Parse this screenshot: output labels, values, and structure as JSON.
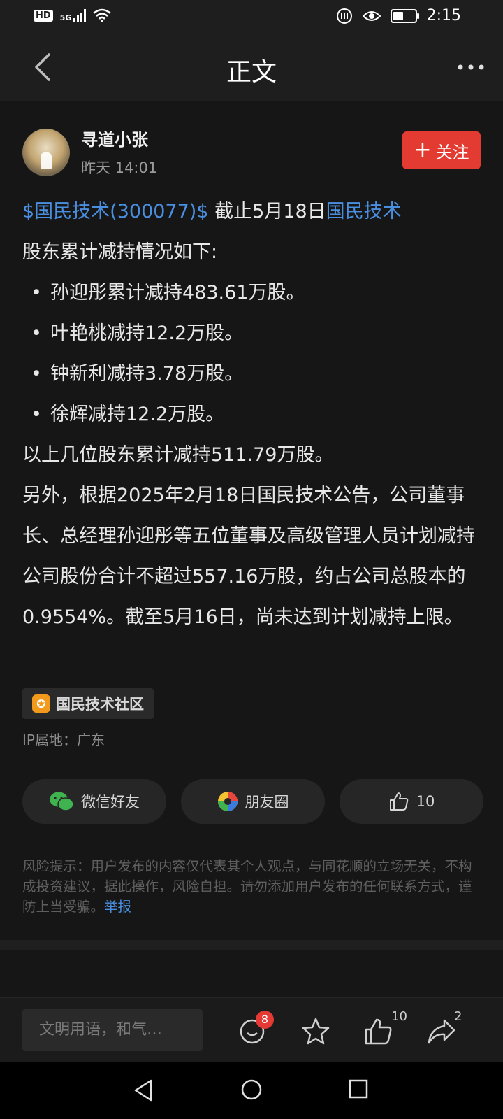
{
  "status_bar": {
    "network": "HD",
    "signal": "5G",
    "time": "2:15"
  },
  "nav": {
    "title": "正文"
  },
  "post": {
    "author": "寻道小张",
    "time": "昨天 14:01",
    "follow_label": "关注",
    "stock_link": "$国民技术(300077)$",
    "line1_mid": " 截止5月18日",
    "company_link": "国民技术",
    "line2": "股东累计减持情况如下:",
    "bullets": [
      "孙迎彤累计减持483.61万股。",
      "叶艳桃减持12.2万股。",
      "钟新利减持3.78万股。",
      "徐辉减持12.2万股。"
    ],
    "summary": "以上几位股东累计减持511.79万股。",
    "paragraph": "另外，根据2025年2月18日国民技术公告，公司董事长、总经理孙迎彤等五位董事及高级管理人员计划减持公司股份合计不超过557.16万股，约占公司总股本的0.9554%。截至5月16日，尚未达到计划减持上限。",
    "topic": "国民技术社区",
    "ip": "IP属地：广东"
  },
  "share": {
    "wechat_label": "微信好友",
    "moments_label": "朋友圈",
    "like_count": "10"
  },
  "disclaimer": {
    "text": "风险提示：用户发布的内容仅代表其个人观点，与同花顺的立场无关，不构成投资建议，据此操作，风险自担。请勿添加用户发布的任何联系方式，谨防上当受骗。",
    "report_label": "举报"
  },
  "bottom_bar": {
    "placeholder": "文明用语，和气…",
    "comment_badge": "8",
    "like_count": "10",
    "share_count": "2"
  },
  "colors": {
    "accent_red": "#e33b32",
    "link_blue": "#4a8fdf",
    "background": "#161616"
  }
}
